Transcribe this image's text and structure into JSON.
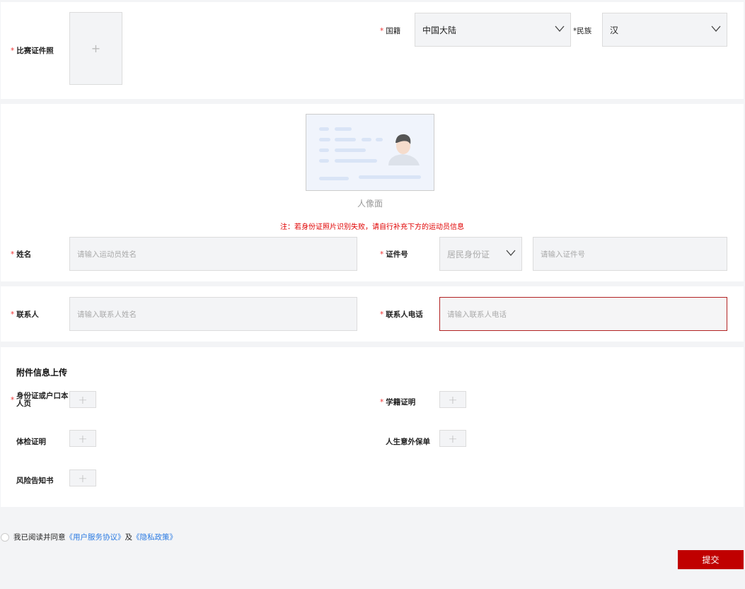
{
  "section1": {
    "photo_label": "比赛证件照",
    "nationality_label": "国籍",
    "nationality_value": "中国大陆",
    "ethnicity_label": "民族",
    "ethnicity_value": "汉"
  },
  "section2": {
    "id_face_label": "人像面",
    "note": "注：若身份证照片识别失败，请自行补充下方的运动员信息",
    "name_label": "姓名",
    "name_placeholder": "请输入运动员姓名",
    "idno_label": "证件号",
    "id_type_value": "居民身份证",
    "idno_placeholder": "请输入证件号"
  },
  "section3": {
    "contact_label": "联系人",
    "contact_placeholder": "请输入联系人姓名",
    "phone_label": "联系人电话",
    "phone_placeholder": "请输入联系人电话"
  },
  "attachments": {
    "title": "附件信息上传",
    "items": [
      {
        "label": "身份证或户口本人页",
        "required": true
      },
      {
        "label": "学籍证明",
        "required": true
      },
      {
        "label": "体检证明",
        "required": false
      },
      {
        "label": "人生意外保单",
        "required": false
      },
      {
        "label": "风险告知书",
        "required": false
      }
    ]
  },
  "agreement": {
    "prefix": "我已阅读并同意",
    "link1": "《用户服务协议》",
    "and": "及",
    "link2": "《隐私政策》",
    "checked": false
  },
  "submit_label": "提交",
  "required_mark": "*",
  "plus_icon": "+",
  "colors": {
    "accent": "#c00000",
    "link": "#2a7ae2",
    "error_border": "#b22222",
    "note": "#e00000"
  }
}
